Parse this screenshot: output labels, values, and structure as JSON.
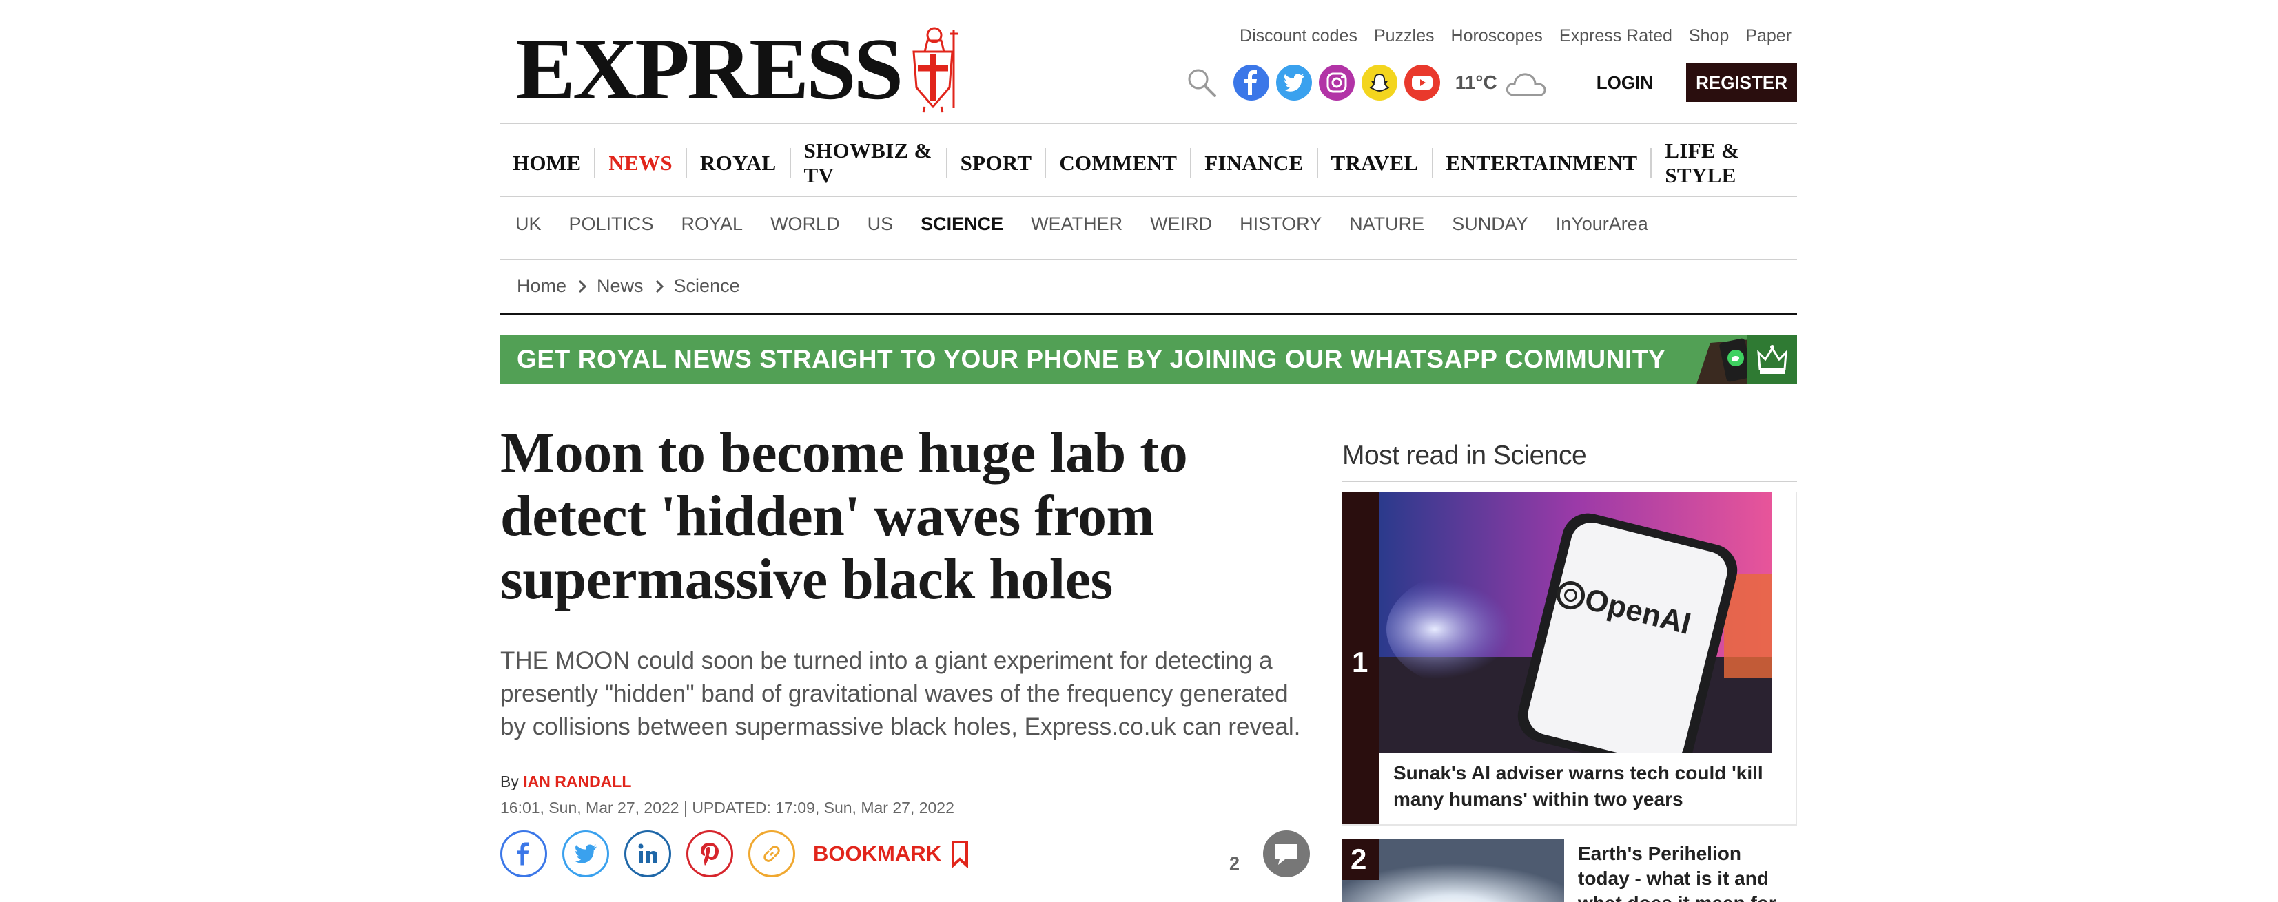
{
  "header": {
    "logo_text": "EXPRESS",
    "top_links": [
      "Discount codes",
      "Puzzles",
      "Horoscopes",
      "Express Rated",
      "Shop",
      "Paper"
    ],
    "weather_temp": "11°C",
    "login_label": "LOGIN",
    "register_label": "REGISTER"
  },
  "main_nav": [
    "HOME",
    "NEWS",
    "ROYAL",
    "SHOWBIZ & TV",
    "SPORT",
    "COMMENT",
    "FINANCE",
    "TRAVEL",
    "ENTERTAINMENT",
    "LIFE & STYLE"
  ],
  "main_nav_active": "NEWS",
  "sub_nav": [
    "UK",
    "POLITICS",
    "ROYAL",
    "WORLD",
    "US",
    "SCIENCE",
    "WEATHER",
    "WEIRD",
    "HISTORY",
    "NATURE",
    "SUNDAY",
    "InYourArea"
  ],
  "sub_nav_active": "SCIENCE",
  "breadcrumb": [
    "Home",
    "News",
    "Science"
  ],
  "banner": {
    "text": "GET ROYAL NEWS STRAIGHT TO YOUR PHONE BY JOINING OUR WHATSAPP COMMUNITY"
  },
  "article": {
    "headline": "Moon to become huge lab to detect 'hidden' waves from supermassive black holes",
    "standfirst": "THE MOON could soon be turned into a giant experiment for detecting a presently \"hidden\" band of gravitational waves of the frequency generated by collisions between supermassive black holes, Express.co.uk can reveal.",
    "byline_prefix": "By",
    "author": "IAN RANDALL",
    "dateline": "16:01, Sun, Mar 27, 2022 | UPDATED: 17:09, Sun, Mar 27, 2022",
    "bookmark_label": "BOOKMARK",
    "comment_count": "2"
  },
  "sidebar": {
    "title": "Most read in Science",
    "items": [
      {
        "rank": "1",
        "image_text": "OpenAI",
        "headline": "Sunak's AI adviser warns tech could 'kill many humans' within two years"
      },
      {
        "rank": "2",
        "headline": "Earth's Perihelion today - what is it and what does it mean for"
      }
    ]
  },
  "colors": {
    "brand_red": "#e1251b",
    "register_bg": "#2a0e0e",
    "banner_green": "#52a055",
    "facebook": "#3b77e8",
    "twitter": "#3aa1ee",
    "linkedin": "#1f67a8",
    "pinterest": "#d6252c",
    "link": "#f0a830"
  }
}
